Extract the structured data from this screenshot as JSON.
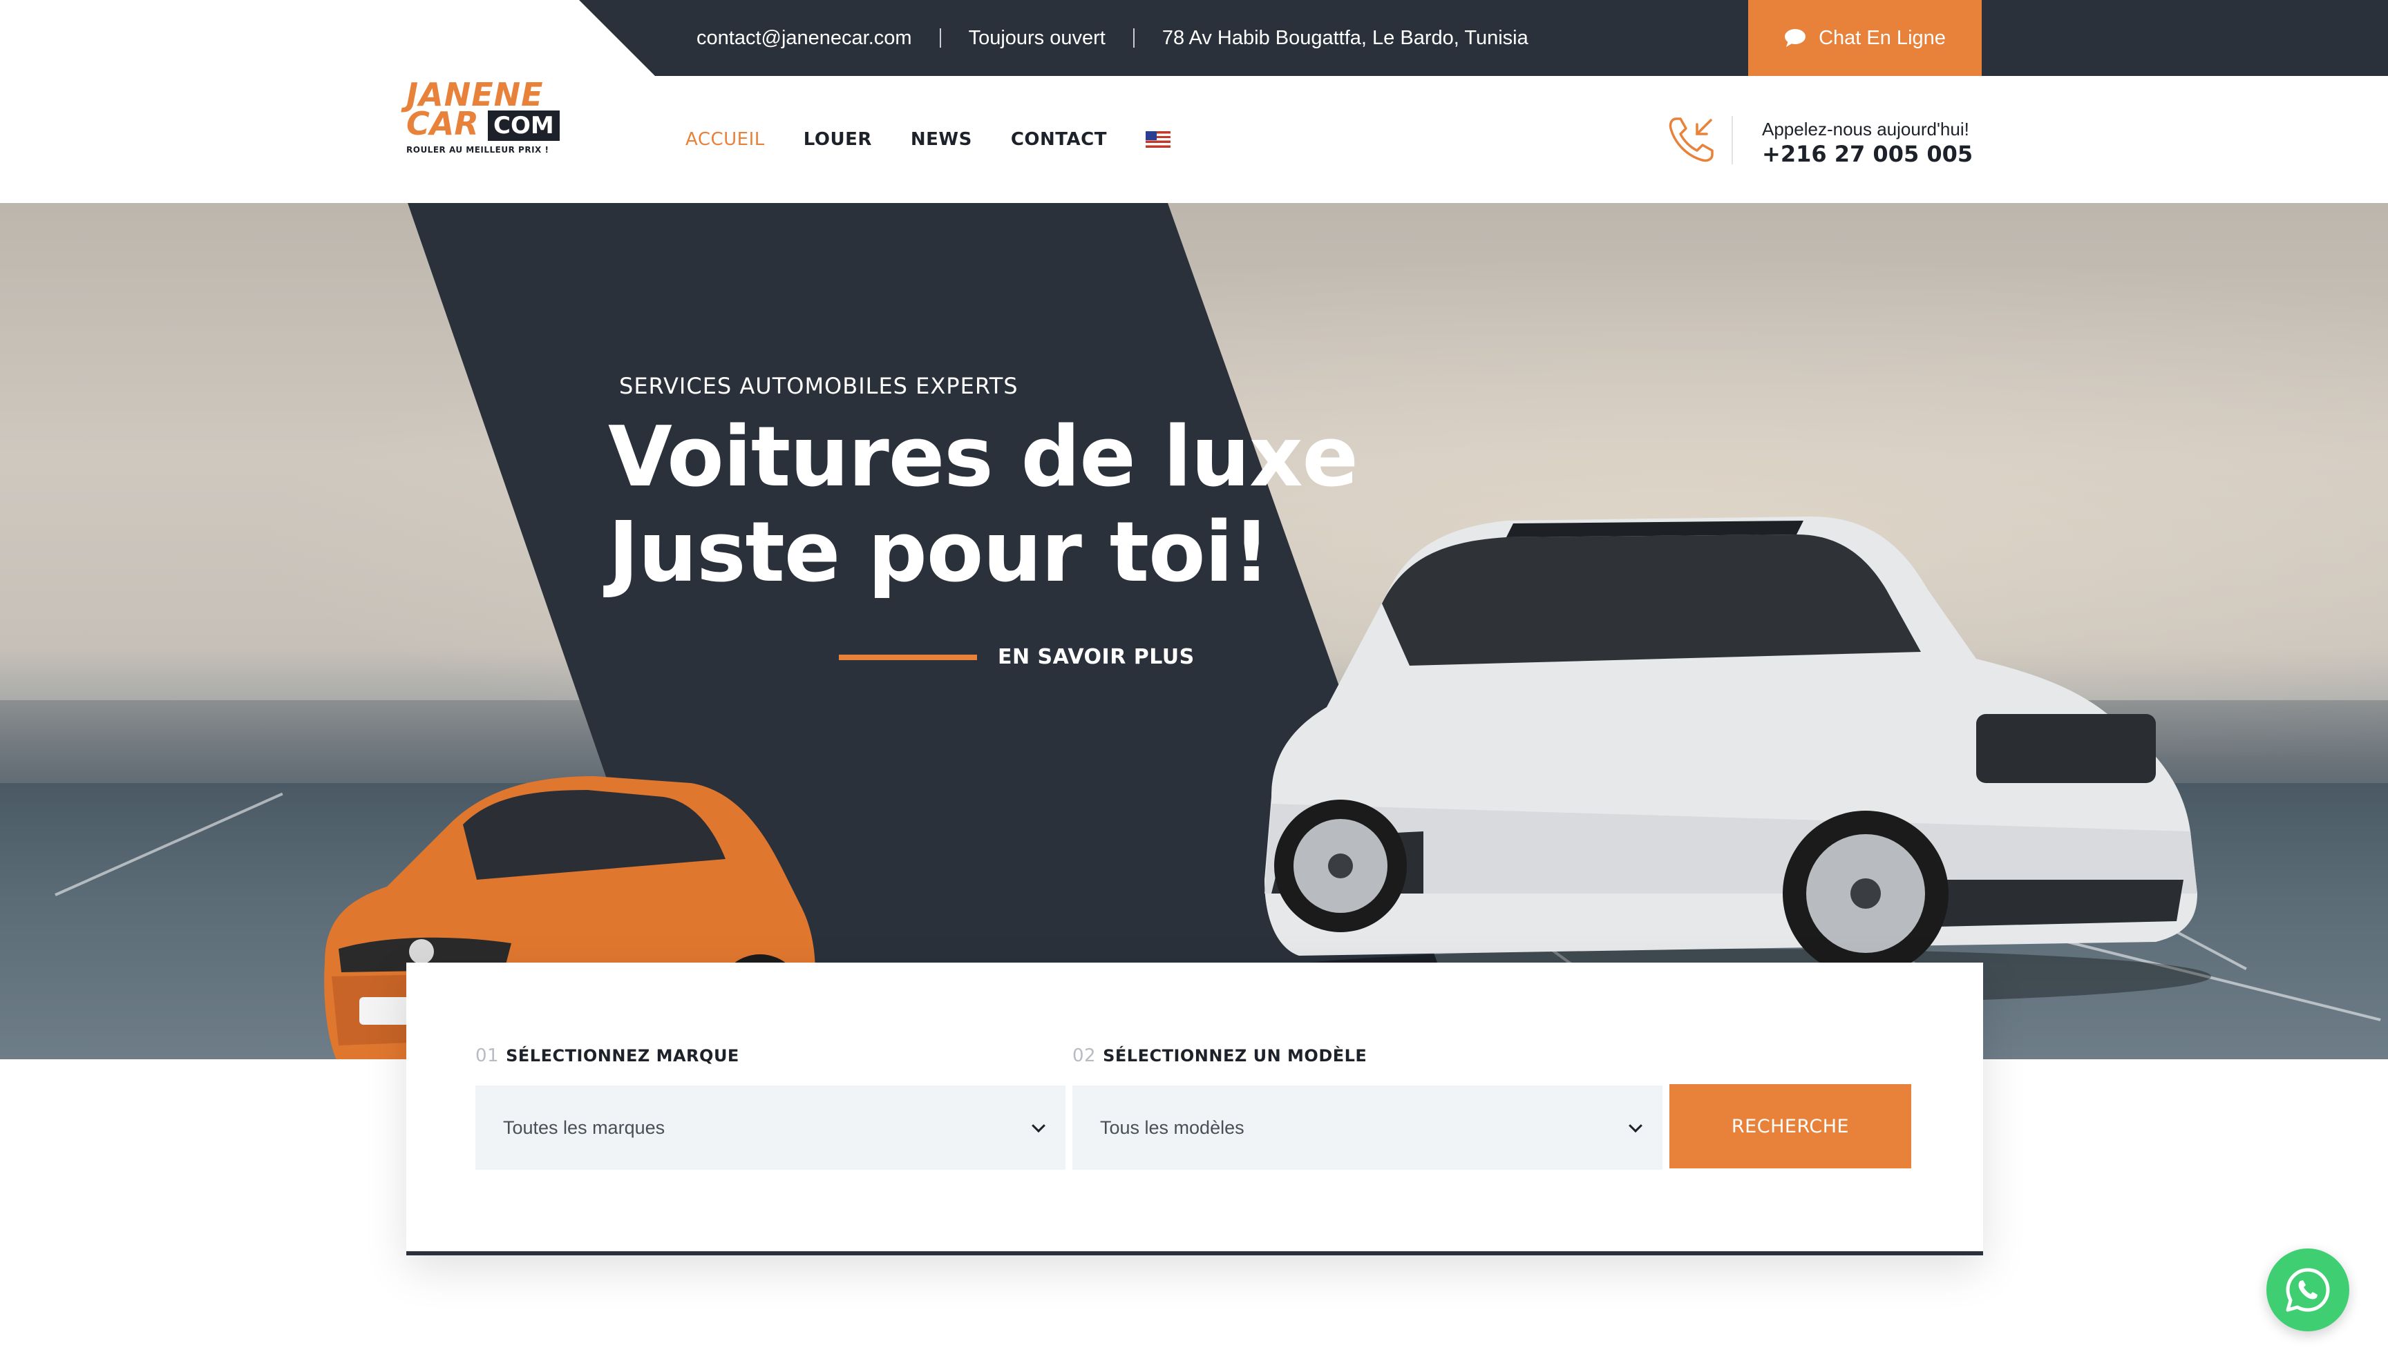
{
  "topbar": {
    "email": "contact@janenecar.com",
    "hours": "Toujours ouvert",
    "address": "78 Av Habib Bougattfa, Le Bardo, Tunisia",
    "chat_label": "Chat En Ligne"
  },
  "logo": {
    "line1": "JANENE",
    "line2": "CAR",
    "com": "COM",
    "tagline": "ROULER AU MEILLEUR PRIX !"
  },
  "nav": {
    "items": [
      {
        "label": "ACCUEIL",
        "active": true
      },
      {
        "label": "LOUER",
        "active": false
      },
      {
        "label": "NEWS",
        "active": false
      },
      {
        "label": "CONTACT",
        "active": false
      }
    ],
    "language_icon": "us-flag-icon"
  },
  "call": {
    "label": "Appelez-nous aujourd'hui!",
    "number": "+216 27 005 005",
    "icon": "phone-incoming-icon"
  },
  "hero": {
    "eyebrow": "SERVICES AUTOMOBILES EXPERTS",
    "title_line1": "Voitures de luxe",
    "title_line2": "Juste pour toi!",
    "cta": "EN SAVOIR PLUS"
  },
  "search": {
    "brand": {
      "num": "01",
      "label": "SÉLECTIONNEZ MARQUE",
      "value": "Toutes les marques"
    },
    "model": {
      "num": "02",
      "label": "SÉLECTIONNEZ UN MODÈLE",
      "value": "Tous les modèles"
    },
    "button": "RECHERCHE"
  },
  "colors": {
    "accent": "#e8823a",
    "dark": "#2a313b",
    "whatsapp": "#3fcf72"
  }
}
